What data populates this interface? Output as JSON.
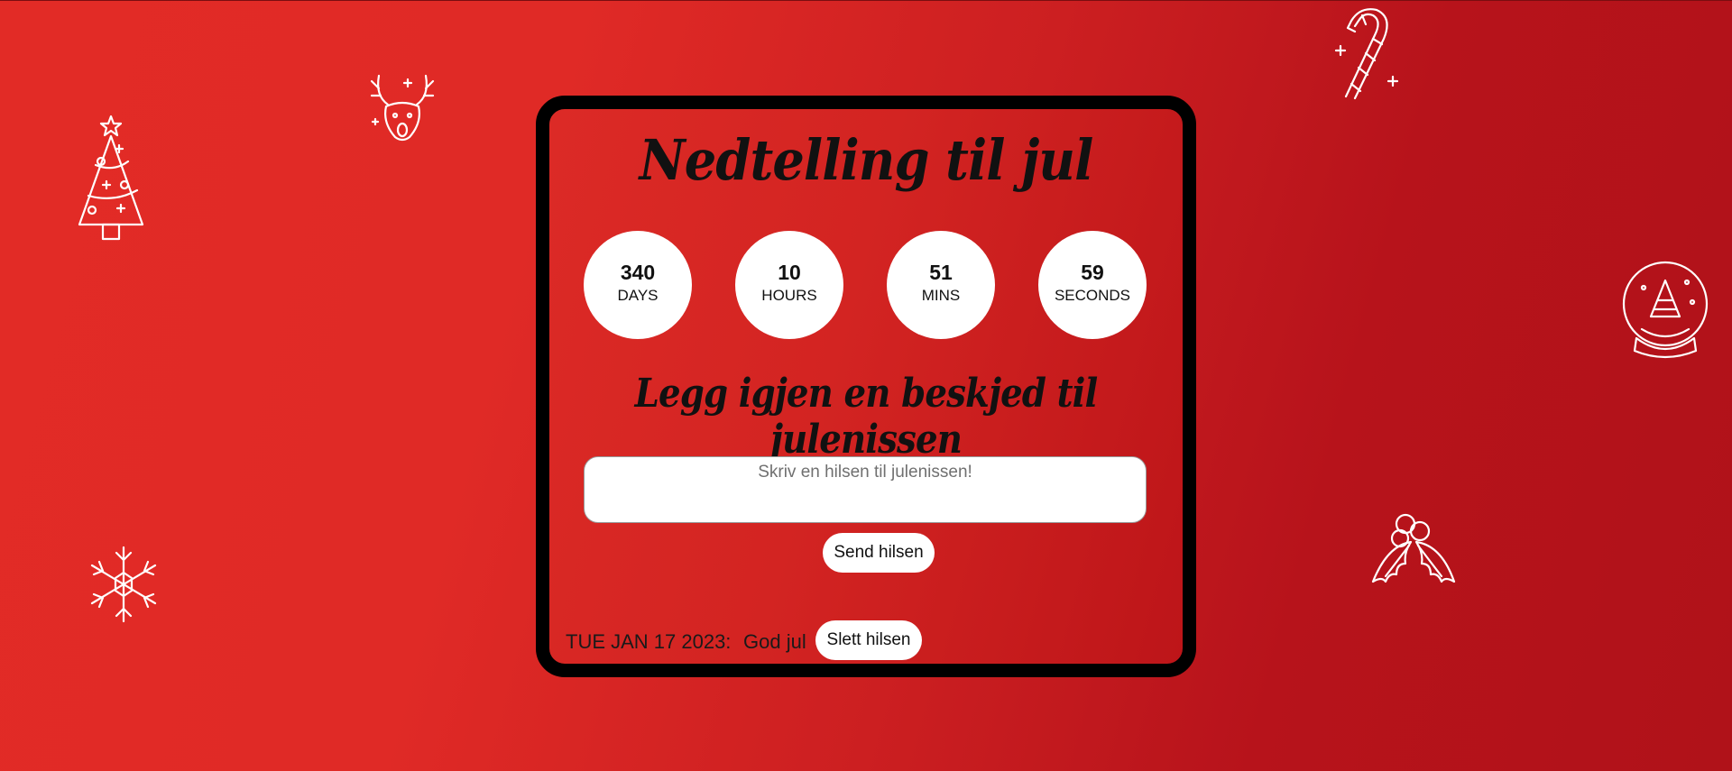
{
  "page": {
    "title": "Nedtelling til jul",
    "background_colors": [
      "#e22b26",
      "#b01219"
    ]
  },
  "countdown": {
    "units": [
      {
        "value": "340",
        "label": "DAYS"
      },
      {
        "value": "10",
        "label": "HOURS"
      },
      {
        "value": "51",
        "label": "MINS"
      },
      {
        "value": "59",
        "label": "SECONDS"
      }
    ]
  },
  "message": {
    "heading": "Legg igjen en beskjed til julenissen",
    "input_placeholder": "Skriv en hilsen til julenissen!",
    "send_label": "Send hilsen"
  },
  "greetings": [
    {
      "date": "TUE JAN 17 2023:",
      "text": "God jul",
      "delete_label": "Slett hilsen"
    }
  ],
  "decorations": [
    "christmas-tree-icon",
    "reindeer-icon",
    "candy-cane-icon",
    "snow-globe-icon",
    "snowflake-icon",
    "holly-icon"
  ]
}
